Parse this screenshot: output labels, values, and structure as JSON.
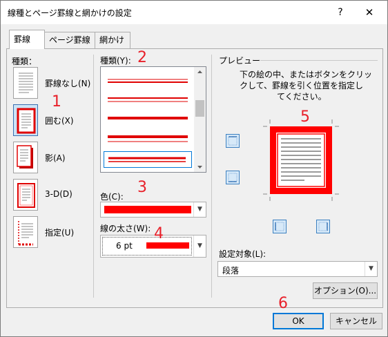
{
  "window": {
    "title": "線種とページ罫線と網かけの設定",
    "help": "?",
    "close": "✕"
  },
  "tabs": [
    "罫線",
    "ページ罫線",
    "網かけ"
  ],
  "setting": {
    "label": "種類：",
    "items": [
      "罫線なし(N)",
      "囲む(X)",
      "影(A)",
      "3-D(D)",
      "指定(U)"
    ]
  },
  "style": {
    "label": "種類(Y):"
  },
  "color": {
    "label": "色(C):",
    "value_color": "#ff0000"
  },
  "width": {
    "label": "線の太さ(W):",
    "value": "6 pt"
  },
  "preview": {
    "label": "プレビュー",
    "instruction": [
      "下の絵の中、またはボタンをクリッ",
      "クして、罫線を引く位置を指定し",
      "てください。"
    ]
  },
  "apply_to": {
    "label": "設定対象(L):",
    "value": "段落"
  },
  "buttons": {
    "options": "オプション(O)...",
    "ok": "OK",
    "cancel": "キャンセル"
  },
  "annotations": [
    "1",
    "2",
    "3",
    "4",
    "5",
    "6"
  ],
  "colors": {
    "accent": "#ff0000",
    "annotation": "#e8202a",
    "focus": "#0078d7"
  }
}
